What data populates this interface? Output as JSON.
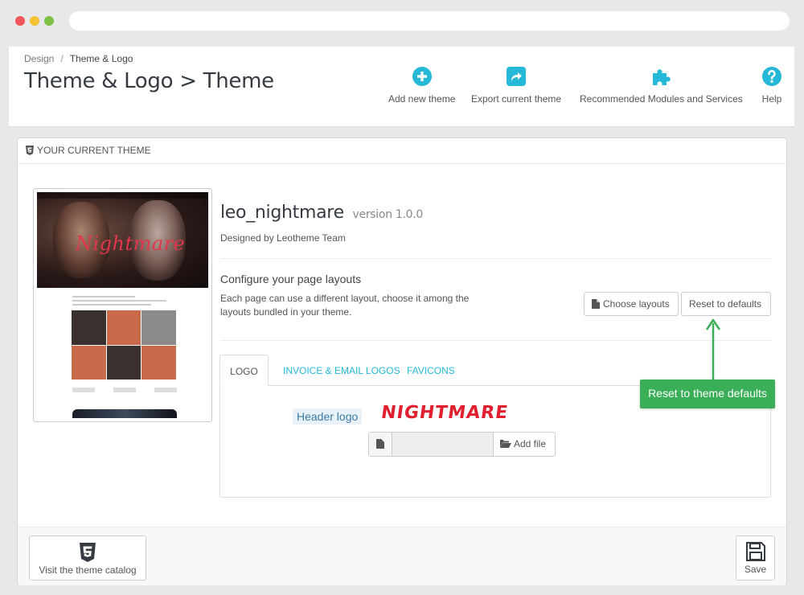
{
  "breadcrumb": {
    "parent": "Design",
    "current": "Theme & Logo"
  },
  "page_title": "Theme & Logo > Theme",
  "toolbar": {
    "add_new_theme": "Add new theme",
    "export_current_theme": "Export current theme",
    "recommended_modules": "Recommended Modules and Services",
    "help": "Help"
  },
  "panel": {
    "heading": "YOUR CURRENT THEME",
    "preview_text": "Nightmare"
  },
  "theme": {
    "name": "leo_nightmare",
    "version": "version 1.0.0",
    "designed_by": "Designed by Leotheme Team"
  },
  "layouts": {
    "title": "Configure your page layouts",
    "description": "Each page can use a different layout, choose it among the layouts bundled in your theme.",
    "choose_button": "Choose layouts",
    "reset_button": "Reset to defaults"
  },
  "tabs": [
    {
      "label": "LOGO",
      "active": true
    },
    {
      "label": "INVOICE & EMAIL LOGOS",
      "active": false
    },
    {
      "label": "FAVICONS",
      "active": false
    }
  ],
  "logo_tab": {
    "header_logo_label": "Header logo",
    "logo_text": "NIGHTMARE",
    "add_file": "Add file"
  },
  "footer": {
    "visit_catalog": "Visit the theme catalog",
    "save": "Save"
  },
  "callout": {
    "text": "Reset to theme defaults"
  },
  "colors": {
    "accent": "#25b9d7",
    "callout_green": "#3bae58",
    "logo_red": "#e0202e"
  }
}
